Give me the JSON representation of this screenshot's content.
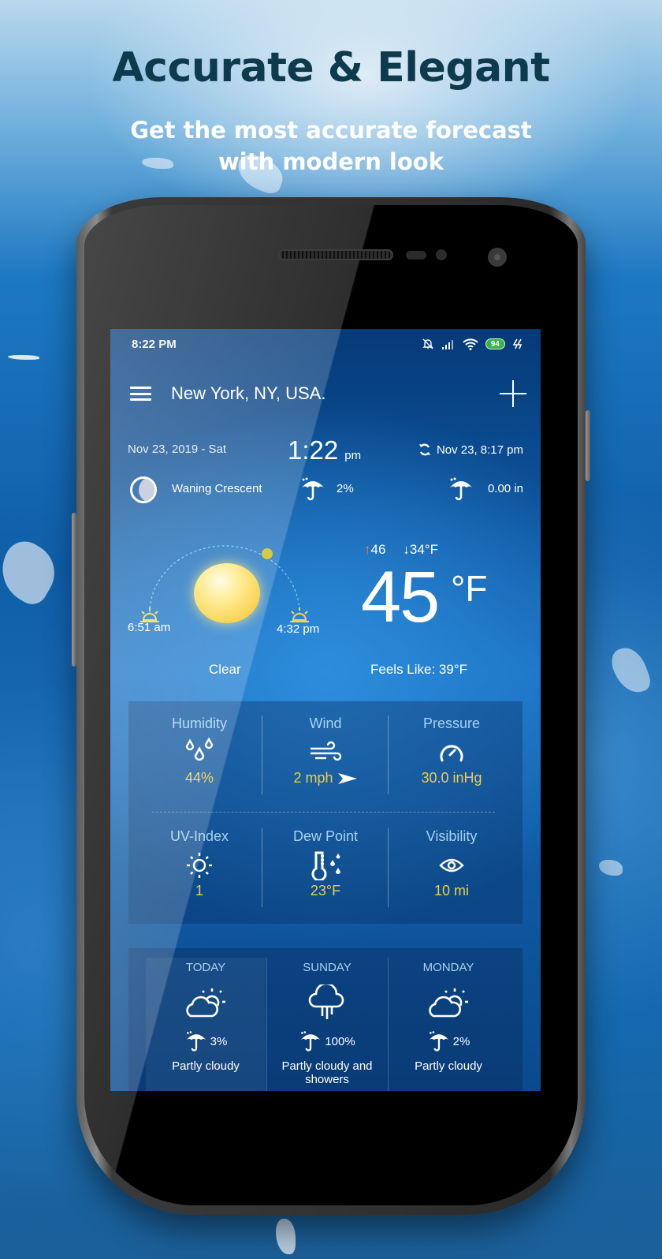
{
  "promo": {
    "headline": "Accurate & Elegant",
    "subline_1": "Get the most accurate forecast",
    "subline_2": "with modern look"
  },
  "status_bar": {
    "time": "8:22 PM",
    "battery": "94",
    "icons": [
      "bell-muted-icon",
      "signal-icon",
      "wifi-icon",
      "battery-icon",
      "charging-icon"
    ]
  },
  "app_bar": {
    "location": "New York, NY, USA.",
    "menu_icon": "hamburger-icon",
    "add_icon": "plus-icon"
  },
  "info": {
    "date": "Nov 23, 2019 - Sat",
    "clock_time": "1:22",
    "clock_ampm": "pm",
    "updated": "Nov 23, 8:17 pm",
    "moon_phase": "Waning Crescent",
    "precip_chance": "2%",
    "precip_amount": "0.00 in"
  },
  "sun": {
    "sunrise": "6:51 am",
    "sunset": "4:32 pm",
    "condition": "Clear"
  },
  "temperature": {
    "high_arrow": "↑",
    "high": "46",
    "low_arrow": "↓",
    "low": "34°F",
    "current": "45",
    "unit": "°F",
    "feels_like": "Feels Like: 39°F"
  },
  "details": [
    {
      "label": "Humidity",
      "icon": "droplets-icon",
      "value": "44%"
    },
    {
      "label": "Wind",
      "icon": "wind-icon",
      "value": "2 mph"
    },
    {
      "label": "Pressure",
      "icon": "gauge-icon",
      "value": "30.0 inHg"
    },
    {
      "label": "UV-Index",
      "icon": "sun-icon",
      "value": "1"
    },
    {
      "label": "Dew Point",
      "icon": "thermometer-drops-icon",
      "value": "23°F"
    },
    {
      "label": "Visibility",
      "icon": "eye-icon",
      "value": "10 mi"
    }
  ],
  "forecast": [
    {
      "day": "TODAY",
      "icon": "partly-cloudy-icon",
      "precip": "3%",
      "desc": "Partly cloudy"
    },
    {
      "day": "SUNDAY",
      "icon": "rain-cloud-icon",
      "precip": "100%",
      "desc": "Partly cloudy and showers"
    },
    {
      "day": "MONDAY",
      "icon": "partly-cloudy-icon",
      "precip": "2%",
      "desc": "Partly cloudy"
    }
  ],
  "colors": {
    "headline": "#0d3a4c",
    "value_yellow": "#e9cf4c",
    "label_blue": "#a8d2f0",
    "high_red": "#f07a7a",
    "battery_green": "#37b34a"
  }
}
